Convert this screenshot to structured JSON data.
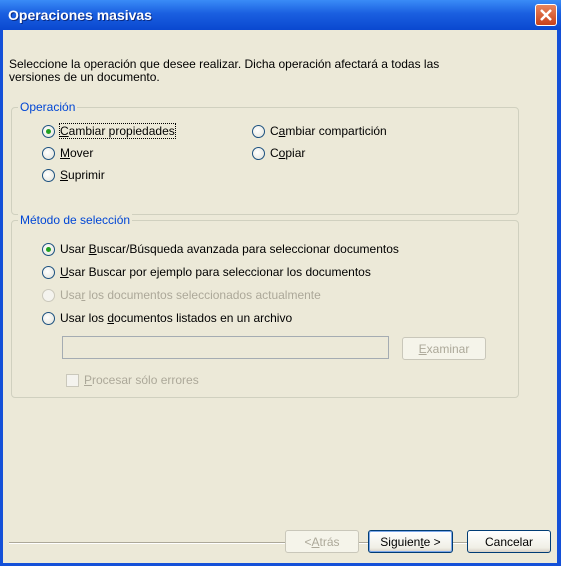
{
  "window": {
    "title": "Operaciones masivas"
  },
  "intro_text": "Seleccione la operación que desee realizar. Dicha operación afectará a todas las versiones de un documento.",
  "operation_group": {
    "legend": "Operación",
    "options": [
      {
        "pre": "",
        "u": "C",
        "post": "ambiar propiedades",
        "checked": true,
        "enabled": true
      },
      {
        "pre": "",
        "u": "M",
        "post": "over",
        "checked": false,
        "enabled": true
      },
      {
        "pre": "",
        "u": "S",
        "post": "uprimir",
        "checked": false,
        "enabled": true
      },
      {
        "pre": "C",
        "u": "a",
        "post": "mbiar compartición",
        "checked": false,
        "enabled": true
      },
      {
        "pre": "C",
        "u": "o",
        "post": "piar",
        "checked": false,
        "enabled": true
      }
    ]
  },
  "selection_group": {
    "legend": "Método de selección",
    "options": [
      {
        "pre": "Usar ",
        "u": "B",
        "post": "uscar/Búsqueda avanzada para seleccionar documentos",
        "checked": true,
        "enabled": true
      },
      {
        "pre": "",
        "u": "U",
        "post": "sar Buscar por ejemplo para seleccionar los documentos",
        "checked": false,
        "enabled": true
      },
      {
        "pre": "Usa",
        "u": "r",
        "post": " los documentos seleccionados actualmente",
        "checked": false,
        "enabled": false
      },
      {
        "pre": "Usar los ",
        "u": "d",
        "post": "ocumentos listados en un archivo",
        "checked": false,
        "enabled": true
      }
    ],
    "file_path_value": "",
    "browse": {
      "pre": "",
      "u": "E",
      "post": "xaminar"
    },
    "only_errors": {
      "pre": "",
      "u": "P",
      "post": "rocesar sólo errores",
      "checked": false,
      "enabled": false
    }
  },
  "buttons": {
    "back": {
      "pre": "< ",
      "u": "A",
      "post": "trás"
    },
    "next": {
      "pre": "Siguien",
      "u": "t",
      "post": "e >"
    },
    "cancel": "Cancelar"
  },
  "colors": {
    "title_bar": "#0a48d0",
    "group_legend": "#0046d5",
    "radio_checked_dot": "#21a121",
    "disabled_text": "#aca899",
    "close_button": "#c8411a"
  }
}
